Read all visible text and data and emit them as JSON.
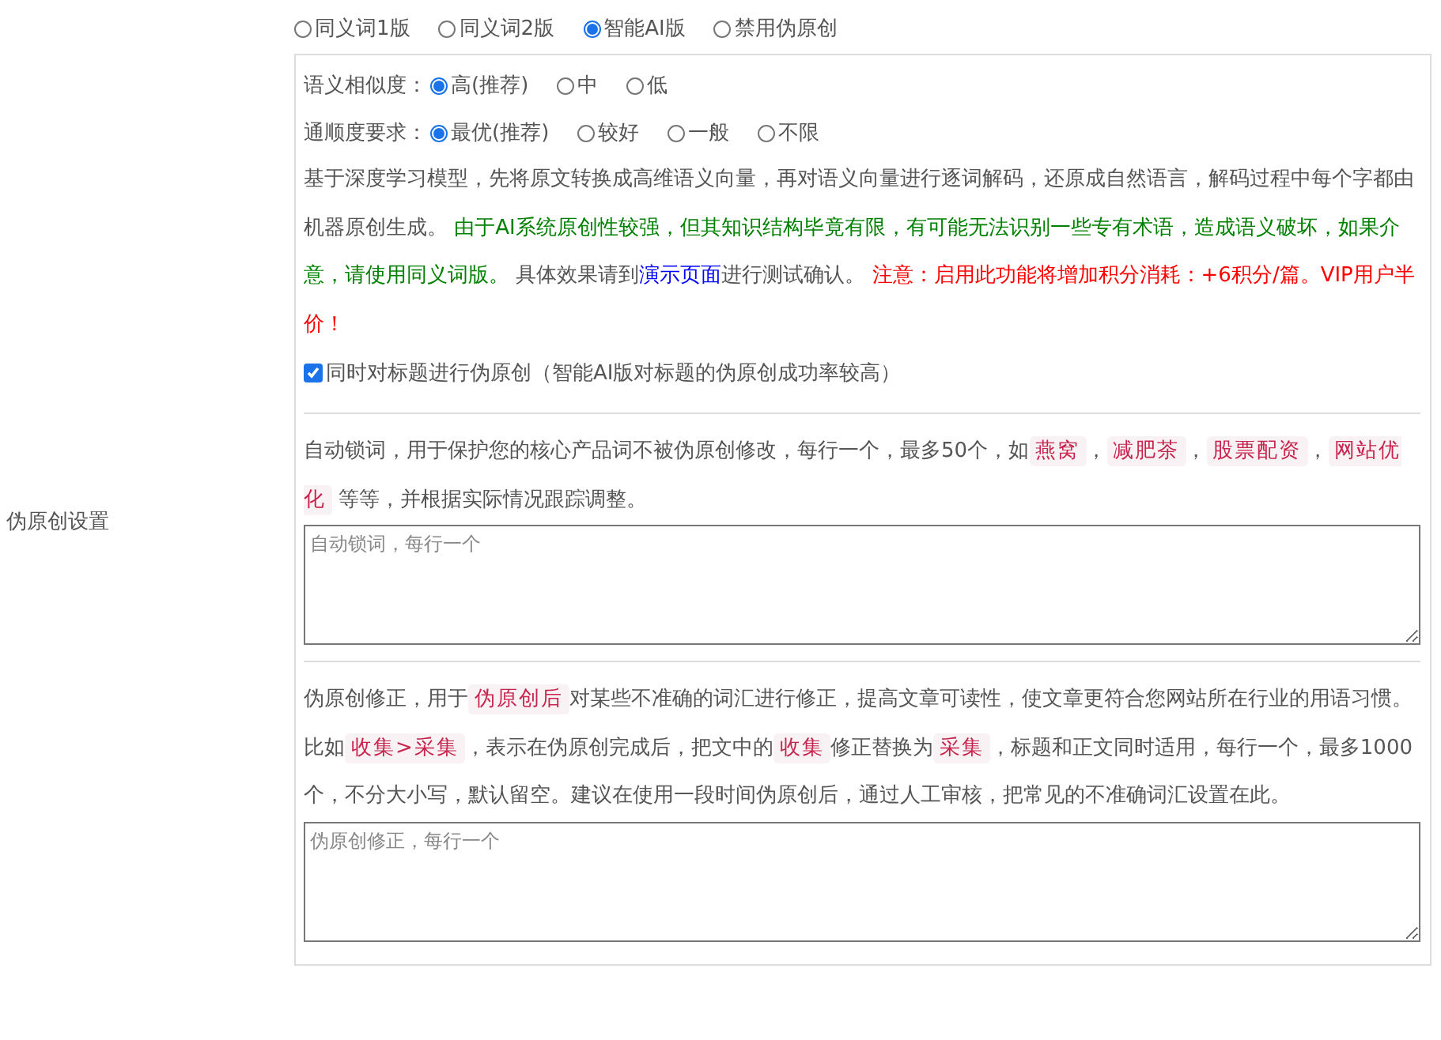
{
  "section_label": "伪原创设置",
  "mode_options": [
    {
      "label": "同义词1版",
      "selected": false
    },
    {
      "label": "同义词2版",
      "selected": false
    },
    {
      "label": "智能AI版",
      "selected": true
    },
    {
      "label": "禁用伪原创",
      "selected": false
    }
  ],
  "ai_settings": {
    "option_rows": [
      {
        "label": "语义相似度：",
        "options": [
          {
            "label": "高(推荐)",
            "selected": true
          },
          {
            "label": "中",
            "selected": false
          },
          {
            "label": "低",
            "selected": false
          }
        ]
      },
      {
        "label": "通顺度要求：",
        "options": [
          {
            "label": "最优(推荐)",
            "selected": true
          },
          {
            "label": "较好",
            "selected": false
          },
          {
            "label": "一般",
            "selected": false
          },
          {
            "label": "不限",
            "selected": false
          }
        ]
      }
    ],
    "description": [
      {
        "kind": "plain",
        "text": "基于深度学习模型，先将原文转换成高维语义向量，再对语义向量进行逐词解码，还原成自然语言，解码过程中每个字都由机器原创生成。 "
      },
      {
        "kind": "green",
        "text": "由于AI系统原创性较强，但其知识结构毕竟有限，有可能无法识别一些专有术语，造成语义破坏，如果介意，请使用同义词版。"
      },
      {
        "kind": "plain",
        "text": " 具体效果请到"
      },
      {
        "kind": "link",
        "text": "演示页面"
      },
      {
        "kind": "plain",
        "text": "进行测试确认。 "
      },
      {
        "kind": "red",
        "text": "注意：启用此功能将增加积分消耗：+6积分/篇。VIP用户半价！"
      }
    ],
    "title_option": {
      "label": "同时对标题进行伪原创（智能AI版对标题的伪原创成功率较高）",
      "checked": true
    }
  },
  "lock_words": {
    "description": [
      {
        "kind": "plain",
        "text": "自动锁词，用于保护您的核心产品词不被伪原创修改，每行一个，最多50个，如"
      },
      {
        "kind": "code",
        "text": "燕窝"
      },
      {
        "kind": "plain",
        "text": "，"
      },
      {
        "kind": "code",
        "text": "减肥茶"
      },
      {
        "kind": "plain",
        "text": "，"
      },
      {
        "kind": "code",
        "text": "股票配资"
      },
      {
        "kind": "plain",
        "text": "，"
      },
      {
        "kind": "code",
        "text": "网站优化"
      },
      {
        "kind": "plain",
        "text": " 等等，并根据实际情况跟踪调整。"
      }
    ],
    "placeholder": "自动锁词，每行一个"
  },
  "correction": {
    "description": [
      {
        "kind": "plain",
        "text": "伪原创修正，用于"
      },
      {
        "kind": "code",
        "text": "伪原创后"
      },
      {
        "kind": "plain",
        "text": "对某些不准确的词汇进行修正，提高文章可读性，使文章更符合您网站所在行业的用语习惯。比如"
      },
      {
        "kind": "code",
        "text": "收集>采集"
      },
      {
        "kind": "plain",
        "text": "，表示在伪原创完成后，把文中的"
      },
      {
        "kind": "code",
        "text": "收集"
      },
      {
        "kind": "plain",
        "text": "修正替换为"
      },
      {
        "kind": "code",
        "text": "采集"
      },
      {
        "kind": "plain",
        "text": "，标题和正文同时适用，每行一个，最多1000个，不分大小写，默认留空。建议在使用一段时间伪原创后，通过人工审核，把常见的不准确词汇设置在此。"
      }
    ],
    "placeholder": "伪原创修正，每行一个"
  }
}
